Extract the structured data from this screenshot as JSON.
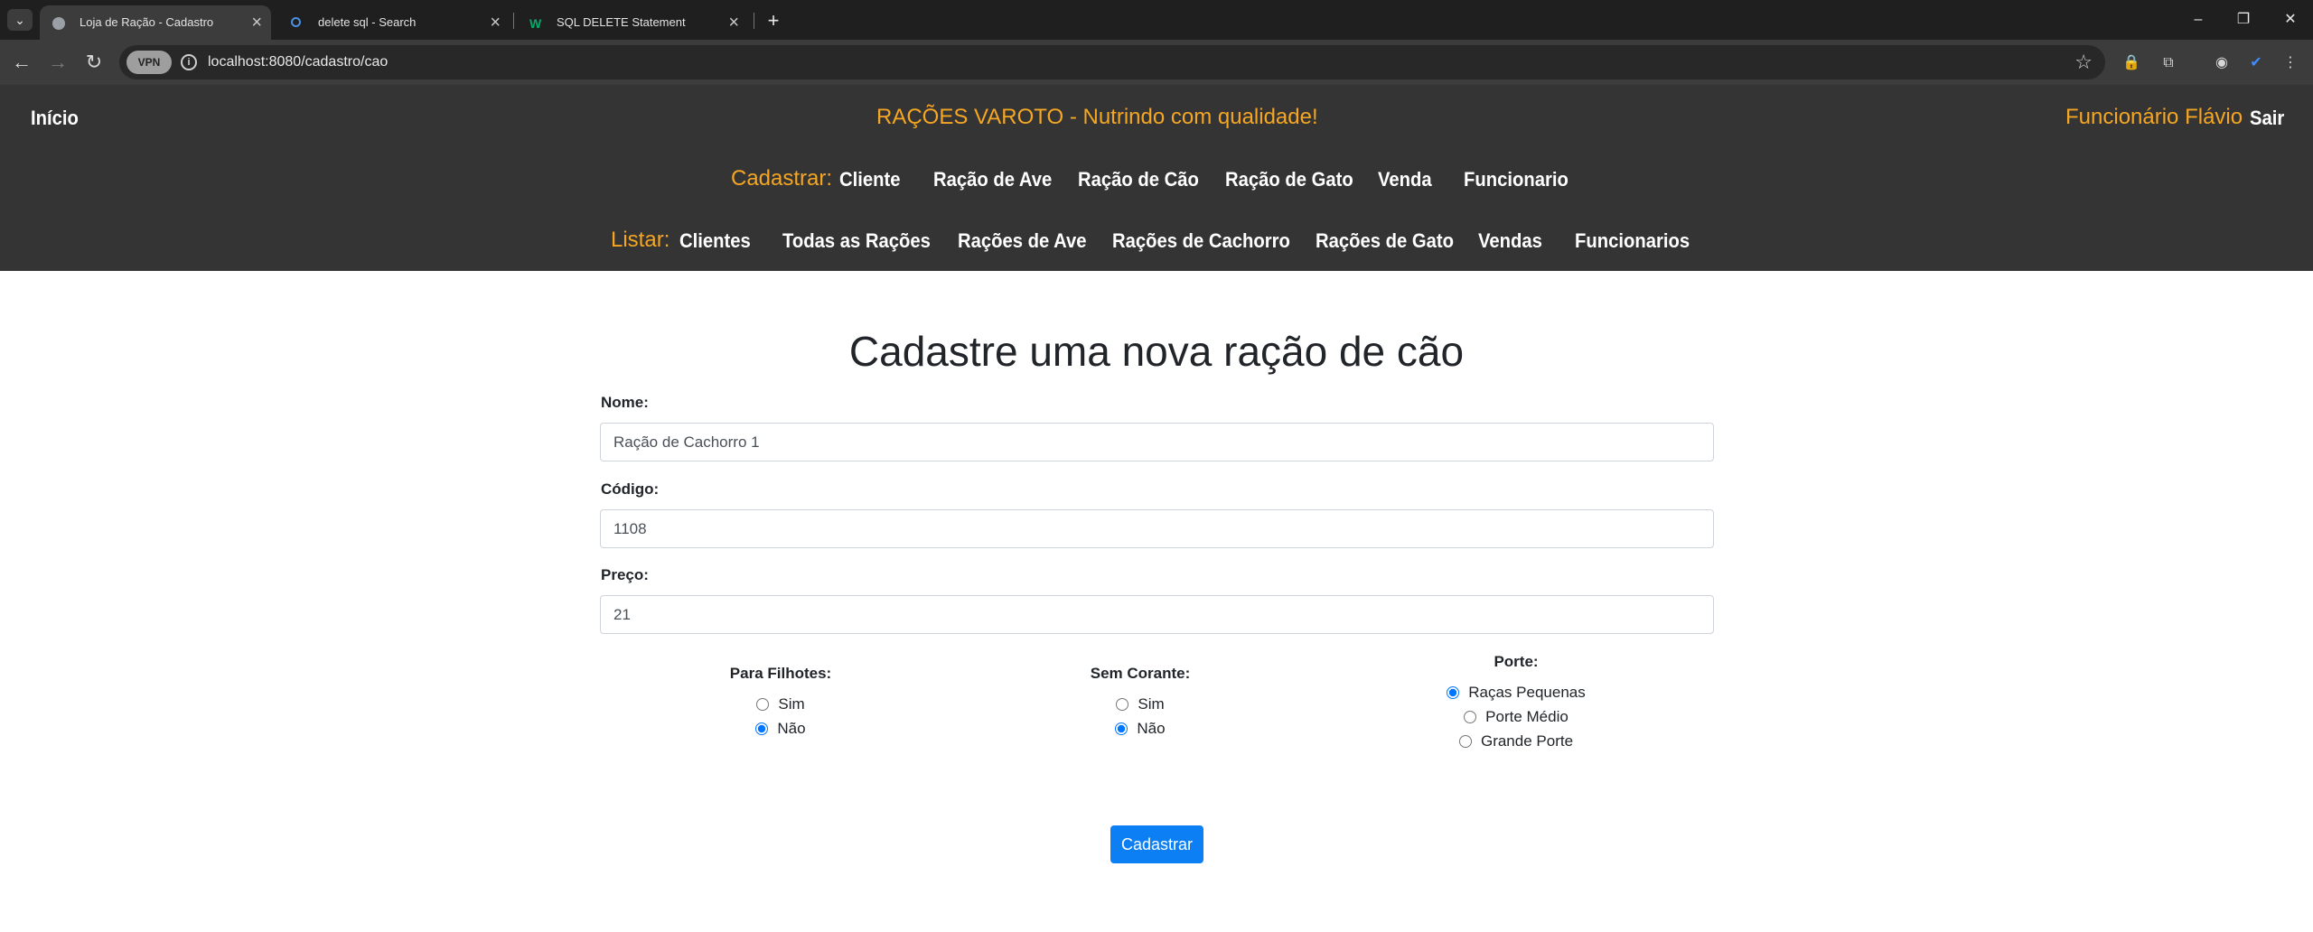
{
  "browser": {
    "tabs": [
      {
        "title": "Loja de Ração - Cadastro",
        "active": true,
        "favicon_color": "#9aa0a6"
      },
      {
        "title": "delete sql - Search",
        "active": false,
        "favicon_color": "#4a90e2"
      },
      {
        "title": "SQL DELETE Statement",
        "active": false,
        "favicon_color": "#04aa6d"
      }
    ],
    "url": "localhost:8080/cadastro/cao",
    "vpn_label": "VPN"
  },
  "header": {
    "home": "Início",
    "brand": "RAÇÕES VAROTO - Nutrindo com qualidade!",
    "user": "Funcionário Flávio",
    "logout": "Sair",
    "register_label": "Cadastrar:",
    "register_links": [
      "Cliente",
      "Ração de Ave",
      "Ração de Cão",
      "Ração de Gato",
      "Venda",
      "Funcionario"
    ],
    "list_label": "Listar:",
    "list_links": [
      "Clientes",
      "Todas as Rações",
      "Rações de Ave",
      "Rações de Cachorro",
      "Rações de Gato",
      "Vendas",
      "Funcionarios"
    ]
  },
  "form": {
    "title": "Cadastre uma nova ração de cão",
    "nome_label": "Nome:",
    "nome_value": "Ração de Cachorro 1",
    "codigo_label": "Código:",
    "codigo_value": "1108",
    "preco_label": "Preço:",
    "preco_value": "21",
    "filhotes": {
      "label": "Para Filhotes:",
      "options": [
        "Sim",
        "Não"
      ],
      "selected": "Não"
    },
    "corante": {
      "label": "Sem Corante:",
      "options": [
        "Sim",
        "Não"
      ],
      "selected": "Não"
    },
    "porte": {
      "label": "Porte:",
      "options": [
        "Raças Pequenas",
        "Porte Médio",
        "Grande Porte"
      ],
      "selected": "Raças Pequenas"
    },
    "submit": "Cadastrar"
  },
  "colors": {
    "accent": "#f5a623",
    "header_bg": "#343434",
    "button": "#0d7ff5"
  }
}
